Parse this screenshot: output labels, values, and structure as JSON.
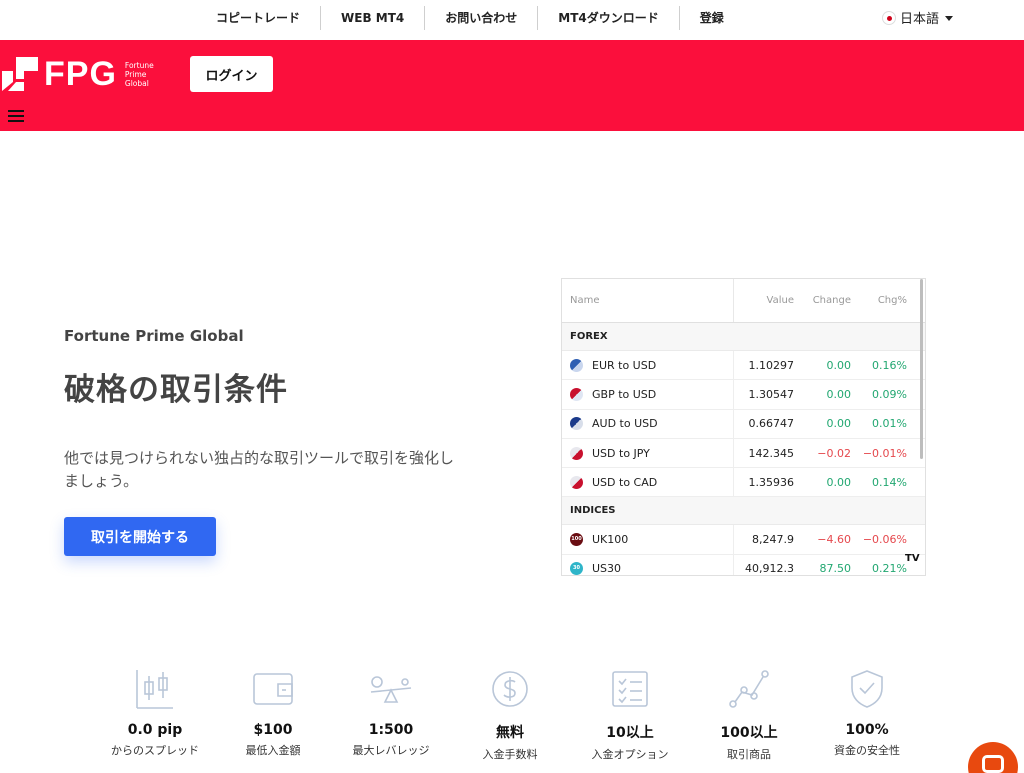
{
  "topnav": {
    "links": [
      "コピートレード",
      "WEB MT4",
      "お問い合わせ",
      "MT4ダウンロード",
      "登録"
    ],
    "language": "日本語"
  },
  "header": {
    "logo_text": "FPG",
    "logo_sub": [
      "Fortune",
      "Prime",
      "Global"
    ],
    "login_label": "ログイン",
    "brand_color": "#fb0f3c"
  },
  "hero": {
    "eyebrow": "Fortune Prime Global",
    "title": "破格の取引条件",
    "description": "他では見つけられない独占的な取引ツールで取引を強化しましょう。",
    "cta_label": "取引を開始する",
    "cta_color": "#3068f2"
  },
  "widget": {
    "columns": {
      "name": "Name",
      "value": "Value",
      "change": "Change",
      "pct": "Chg%"
    },
    "groups": [
      {
        "label": "FOREX",
        "rows": [
          {
            "icon": "fx",
            "name": "EUR to USD",
            "value": "1.10297",
            "change": "0.00",
            "pct": "0.16%",
            "dir": "pos"
          },
          {
            "icon": "gbp",
            "name": "GBP to USD",
            "value": "1.30547",
            "change": "0.00",
            "pct": "0.09%",
            "dir": "pos"
          },
          {
            "icon": "aud",
            "name": "AUD to USD",
            "value": "0.66747",
            "change": "0.00",
            "pct": "0.01%",
            "dir": "pos"
          },
          {
            "icon": "usd",
            "name": "USD to JPY",
            "value": "142.345",
            "change": "−0.02",
            "pct": "−0.01%",
            "dir": "neg"
          },
          {
            "icon": "usd",
            "name": "USD to CAD",
            "value": "1.35936",
            "change": "0.00",
            "pct": "0.14%",
            "dir": "pos"
          }
        ]
      },
      {
        "label": "INDICES",
        "rows": [
          {
            "icon": "uk100",
            "name": "UK100",
            "value": "8,247.9",
            "change": "−4.60",
            "pct": "−0.06%",
            "dir": "neg",
            "badge": "100"
          },
          {
            "icon": "us30",
            "name": "US30",
            "value": "40,912.3",
            "change": "87.50",
            "pct": "0.21%",
            "dir": "pos",
            "badge": "30"
          }
        ]
      }
    ],
    "tv_logo": "TV"
  },
  "features": [
    {
      "icon": "candlestick-icon",
      "title": "0.0 pip",
      "sub": "からのスプレッド"
    },
    {
      "icon": "wallet-icon",
      "title": "$100",
      "sub": "最低入金額"
    },
    {
      "icon": "seesaw-icon",
      "title": "1:500",
      "sub": "最大レバレッジ"
    },
    {
      "icon": "dollar-coin-icon",
      "title": "無料",
      "sub": "入金手数料"
    },
    {
      "icon": "checklist-icon",
      "title": "10以上",
      "sub": "入金オプション"
    },
    {
      "icon": "line-chart-icon",
      "title": "100以上",
      "sub": "取引商品"
    },
    {
      "icon": "shield-check-icon",
      "title": "100%",
      "sub": "資金の安全性"
    }
  ],
  "chat": {
    "icon": "chat-bubble-icon",
    "color": "#e8490f"
  }
}
